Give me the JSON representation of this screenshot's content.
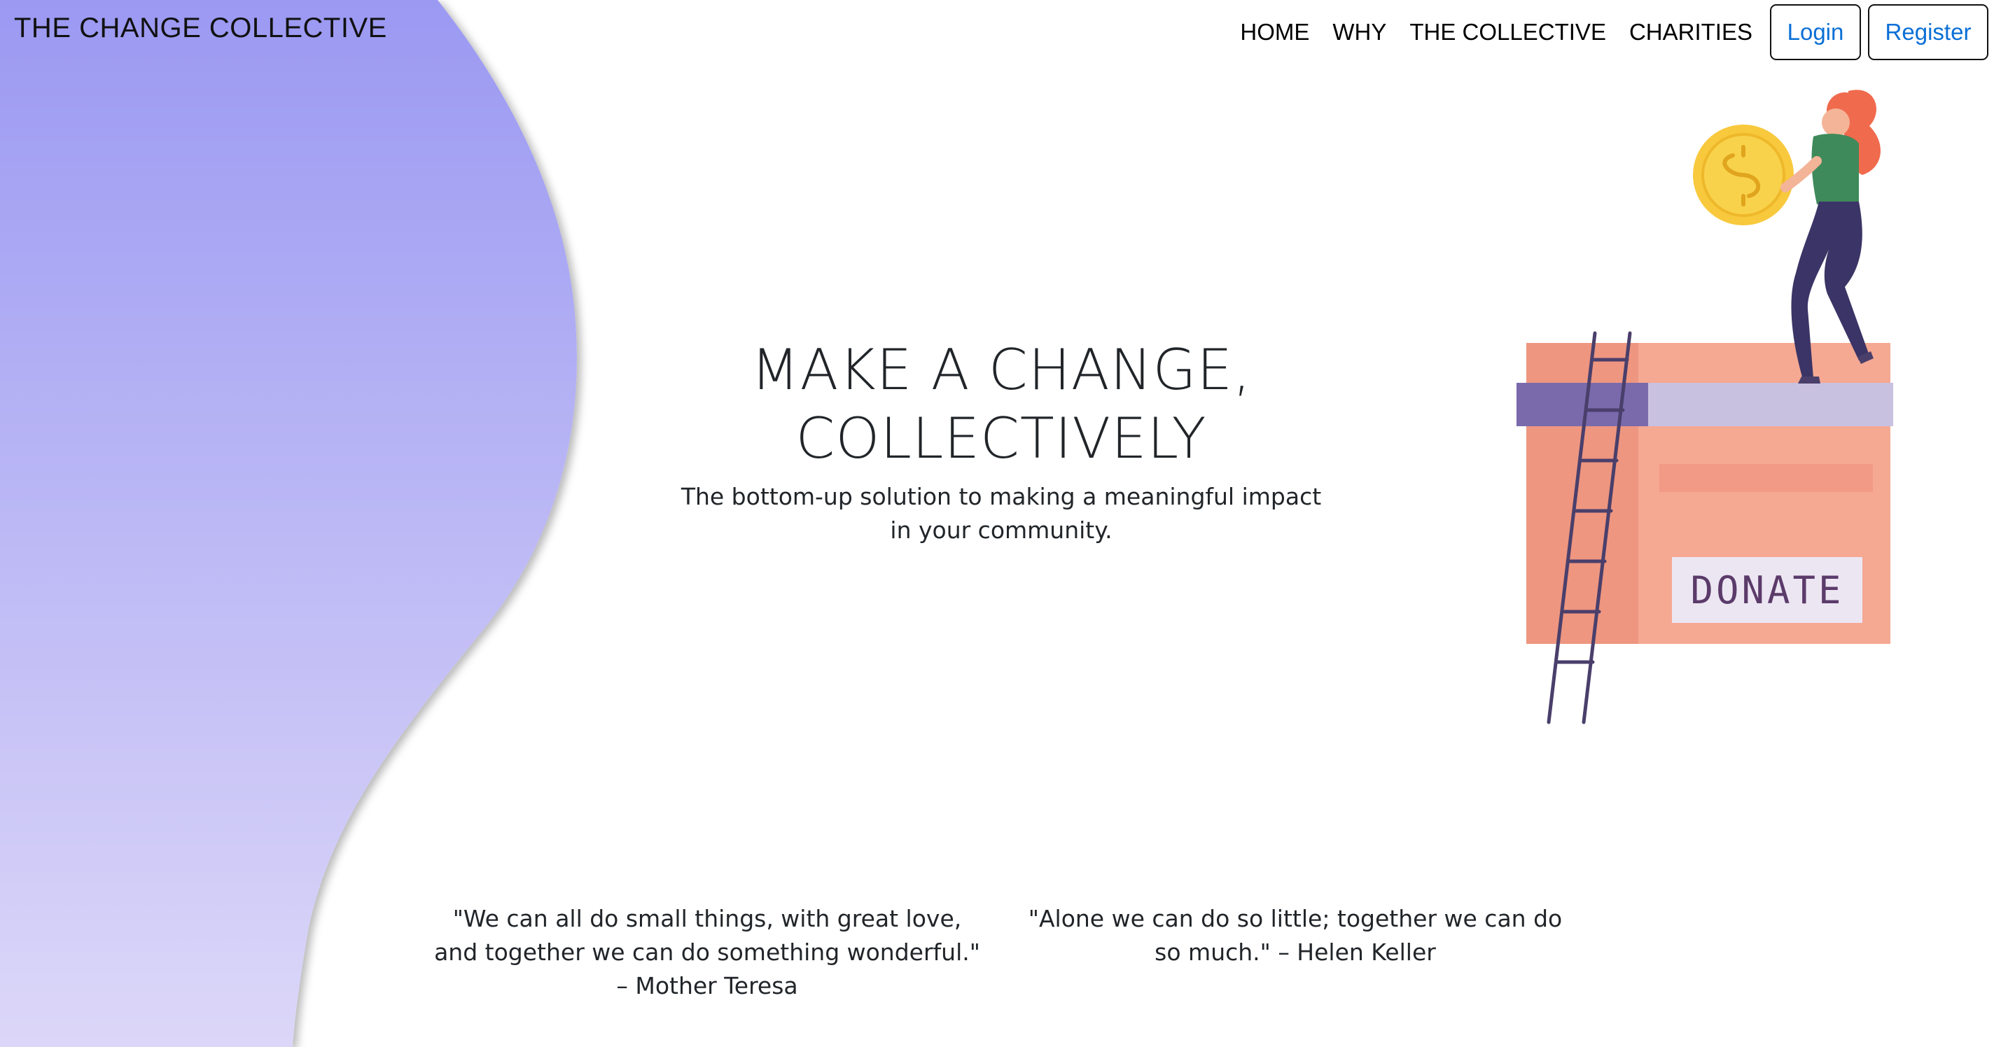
{
  "brand": "THE CHANGE COLLECTIVE",
  "nav": {
    "links": [
      "HOME",
      "WHY",
      "THE COLLECTIVE",
      "CHARITIES"
    ],
    "login_label": "Login",
    "register_label": "Register"
  },
  "hero": {
    "title_line1": "MAKE A CHANGE,",
    "title_line2": "COLLECTIVELY",
    "subtitle": "The bottom-up solution to making a meaningful impact in your community."
  },
  "illustration": {
    "box_label": "DONATE",
    "icons": [
      "woman-figure",
      "gold-coin",
      "ladder",
      "donation-box"
    ]
  },
  "quotes": [
    "\"We can all do small things, with great love, and together we can do something wonderful.\" – Mother Teresa",
    "\"Alone we can do so little; together we can do so much.\" – Helen Keller"
  ],
  "colors": {
    "blob_top": "#9b99f2",
    "blob_bottom": "#dcd7f8",
    "box": "#f5a892",
    "box_lid": "#c9c1e0",
    "lid_dark": "#7a6aac",
    "ladder": "#4a3f6b",
    "coin": "#f8c93d",
    "hair": "#f06a4e",
    "shirt": "#3f8a5a",
    "pants": "#3b3466",
    "link_blue": "#0a6fd6"
  }
}
